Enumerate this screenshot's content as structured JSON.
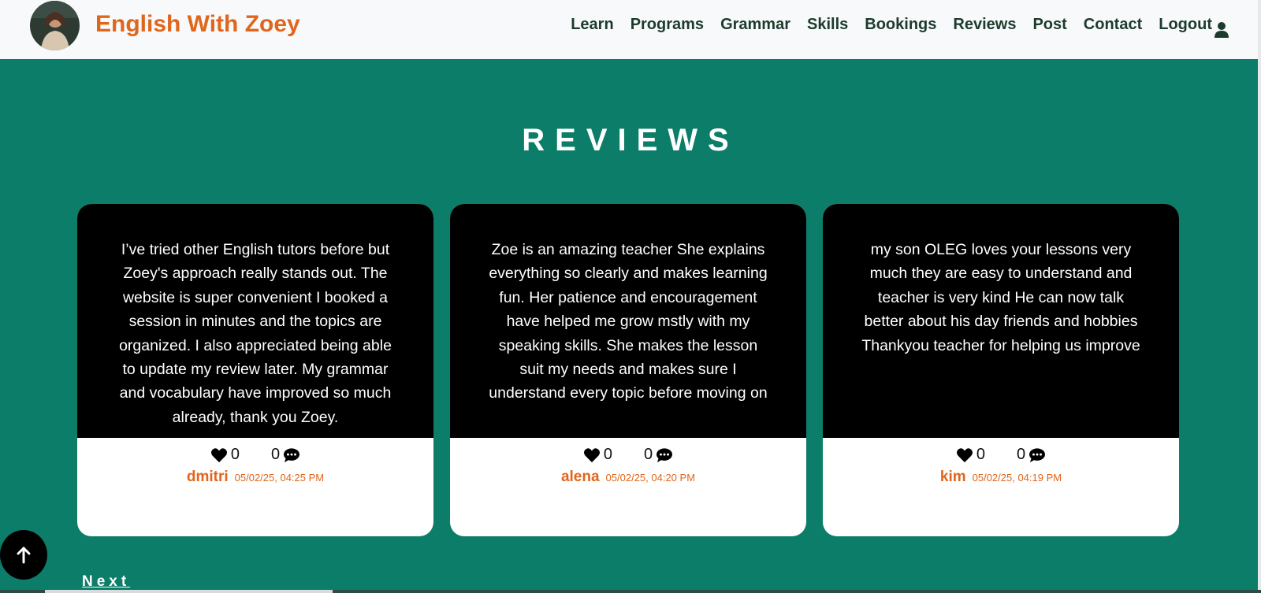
{
  "nav": {
    "brand": "English With Zoey",
    "links": [
      "Learn",
      "Programs",
      "Grammar",
      "Skills",
      "Bookings",
      "Reviews",
      "Post",
      "Contact",
      "Logout"
    ]
  },
  "section": {
    "title": "REVIEWS"
  },
  "reviews": [
    {
      "text": "I’ve tried other English tutors before but Zoey's approach really stands out. The website is super convenient I booked a session in minutes and the topics are organized. I also appreciated being able to update my review later. My grammar and vocabulary have improved so much already, thank you Zoey.",
      "likes": "0",
      "comments": "0",
      "author": "dmitri",
      "date": "05/02/25, 04:25 PM"
    },
    {
      "text": "Zoe is an amazing teacher She explains everything so clearly and makes learning fun. Her patience and encouragement have helped me grow mstly with my speaking skills. She makes the lesson suit my needs and makes sure I understand every topic before moving on",
      "likes": "0",
      "comments": "0",
      "author": "alena",
      "date": "05/02/25, 04:20 PM"
    },
    {
      "text": "my son OLEG loves your lessons very much they are easy to understand and teacher is very kind He can now talk better about his day friends and hobbies Thankyou teacher for helping us improve",
      "likes": "0",
      "comments": "0",
      "author": "kim",
      "date": "05/02/25, 04:19 PM"
    }
  ],
  "pagination": {
    "next_label": "Next"
  },
  "colors": {
    "accent": "#e0661b",
    "background": "#0c7d69",
    "nav_text": "#1d3b2c"
  },
  "icons": {
    "like": "heart-icon",
    "comment": "comment-icon",
    "profile": "user-icon",
    "scroll_top": "arrow-up-icon"
  }
}
